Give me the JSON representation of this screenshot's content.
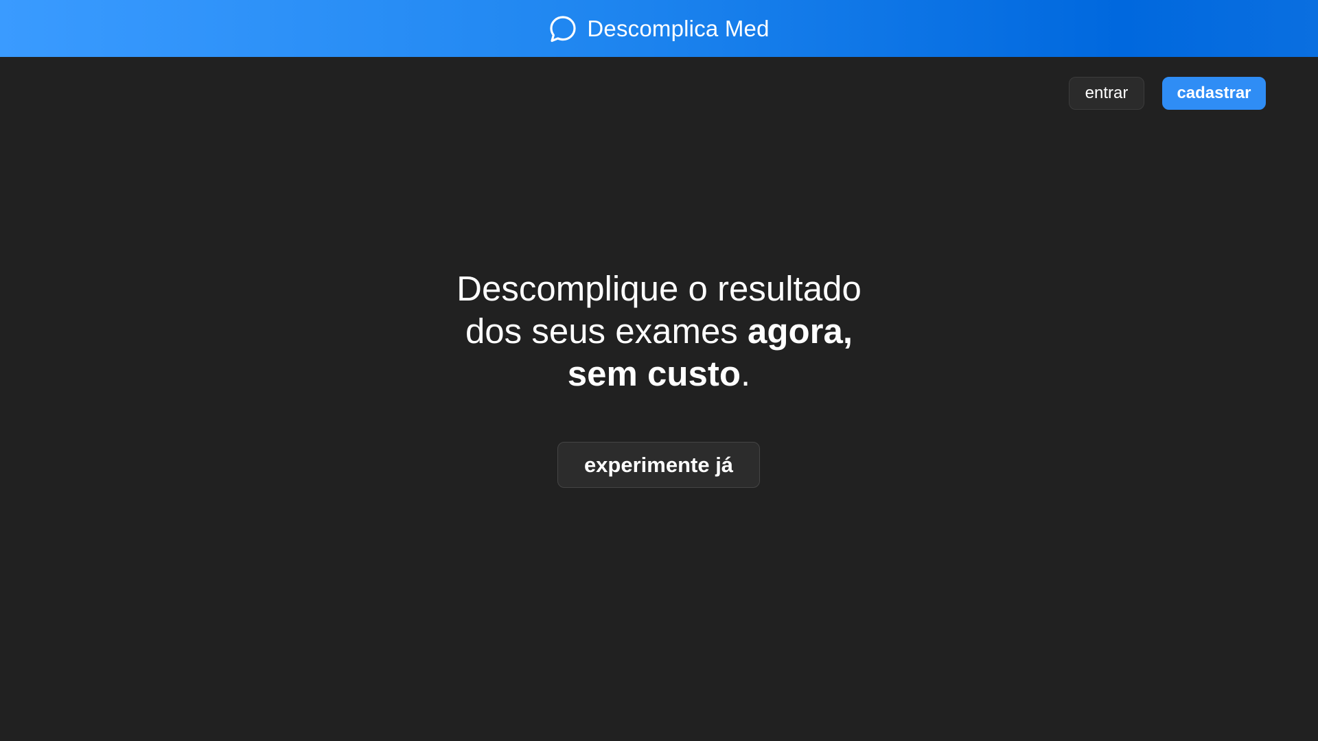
{
  "header": {
    "brand_name": "Descomplica Med",
    "logo_icon": "chat-bubble-icon",
    "background_gradient": [
      "#3a9bff",
      "#0068de"
    ]
  },
  "auth": {
    "login_label": "entrar",
    "signup_label": "cadastrar",
    "signup_color": "#2f8df5"
  },
  "hero": {
    "line1": "Descomplique o resultado",
    "line2_regular": "dos seus exames ",
    "line2_bold": "agora,",
    "line3_bold": "sem custo",
    "line3_regular": "."
  },
  "cta": {
    "label": "experimente já"
  },
  "colors": {
    "page_background": "#212121",
    "text": "#ffffff"
  }
}
